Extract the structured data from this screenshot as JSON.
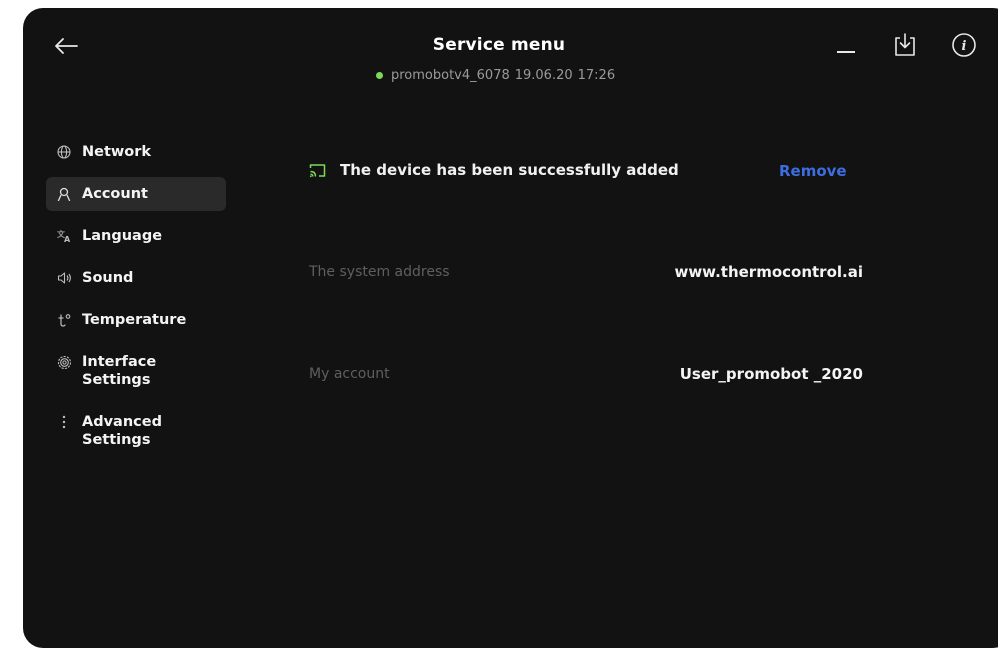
{
  "header": {
    "title": "Service menu",
    "device_id": "promobotv4_6078",
    "date": "19.06.20",
    "time": "17:26",
    "status_color": "#7ed957"
  },
  "icons": {
    "back": "arrow-left-icon",
    "minimize": "minimize-icon",
    "download": "download-icon",
    "info": "info-icon"
  },
  "sidebar": {
    "items": [
      {
        "label": "Network",
        "icon": "globe-icon",
        "active": false
      },
      {
        "label": "Account",
        "icon": "user-icon",
        "active": true
      },
      {
        "label": "Language",
        "icon": "translate-icon",
        "active": false
      },
      {
        "label": "Sound",
        "icon": "speaker-icon",
        "active": false
      },
      {
        "label": "Temperature",
        "icon": "thermometer-icon",
        "active": false
      },
      {
        "label": "Interface Settings",
        "icon": "settings-gear-icon",
        "active": false
      },
      {
        "label": "Advanced Settings",
        "icon": "more-vertical-icon",
        "active": false
      }
    ]
  },
  "main": {
    "device_message": "The device has been successfully added",
    "device_icon": "cast-icon",
    "remove_label": "Remove",
    "fields": [
      {
        "label": "The system address",
        "value": "www.thermocontrol.ai"
      },
      {
        "label": "My account",
        "value": "User_promobot _2020"
      }
    ]
  },
  "colors": {
    "background": "#121212",
    "accent_green": "#7ed957",
    "link_blue": "#3d6de0",
    "active_item_bg": "#2a2a2a"
  }
}
